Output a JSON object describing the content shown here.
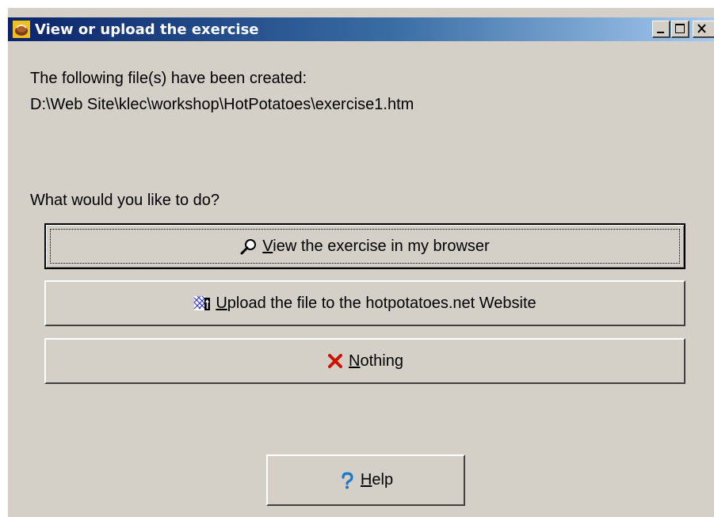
{
  "window": {
    "title": "View or upload the exercise",
    "icon": "hotpotatoes-app-icon",
    "controls": [
      "minimize-icon",
      "maximize-icon",
      "close-icon"
    ]
  },
  "message": {
    "line1": "The following file(s) have been created:",
    "path": "D:\\Web Site\\klec\\workshop\\HotPotatoes\\exercise1.htm",
    "question": "What would you like to do?"
  },
  "buttons": {
    "view": {
      "access_key": "V",
      "rest": "iew the exercise in my browser",
      "icon": "magnifier-icon"
    },
    "upload": {
      "access_key": "U",
      "rest": "pload the file to the hotpotatoes.net Website",
      "icon": "web-upload-icon"
    },
    "nothing": {
      "access_key": "N",
      "rest": "othing",
      "icon": "red-x-icon"
    },
    "help": {
      "access_key": "H",
      "rest": "elp",
      "icon": "question-icon"
    }
  },
  "colors": {
    "face": "#d4d0c8",
    "title_start": "#0a246a",
    "title_end": "#a6caf0",
    "cancel_red": "#cc1100",
    "help_blue": "#1e78c8"
  }
}
